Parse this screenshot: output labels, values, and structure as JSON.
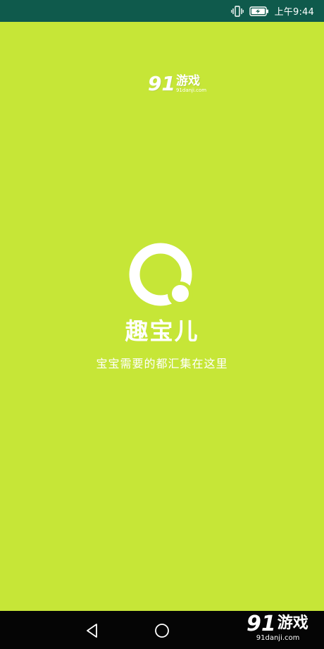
{
  "status_bar": {
    "time": "上午9:44",
    "icons": [
      "vibrate-icon",
      "battery-charging-icon"
    ],
    "background": "#0f5a4c"
  },
  "watermark": {
    "number": "91",
    "name": "游戏",
    "url": "91danji.com"
  },
  "app": {
    "name": "趣宝儿",
    "slogan": "宝宝需要的都汇集在这里",
    "background": "#c6e637",
    "logo_icon": "app-logo-icon"
  },
  "nav_bar": {
    "icons": [
      "back-icon",
      "home-icon"
    ]
  }
}
